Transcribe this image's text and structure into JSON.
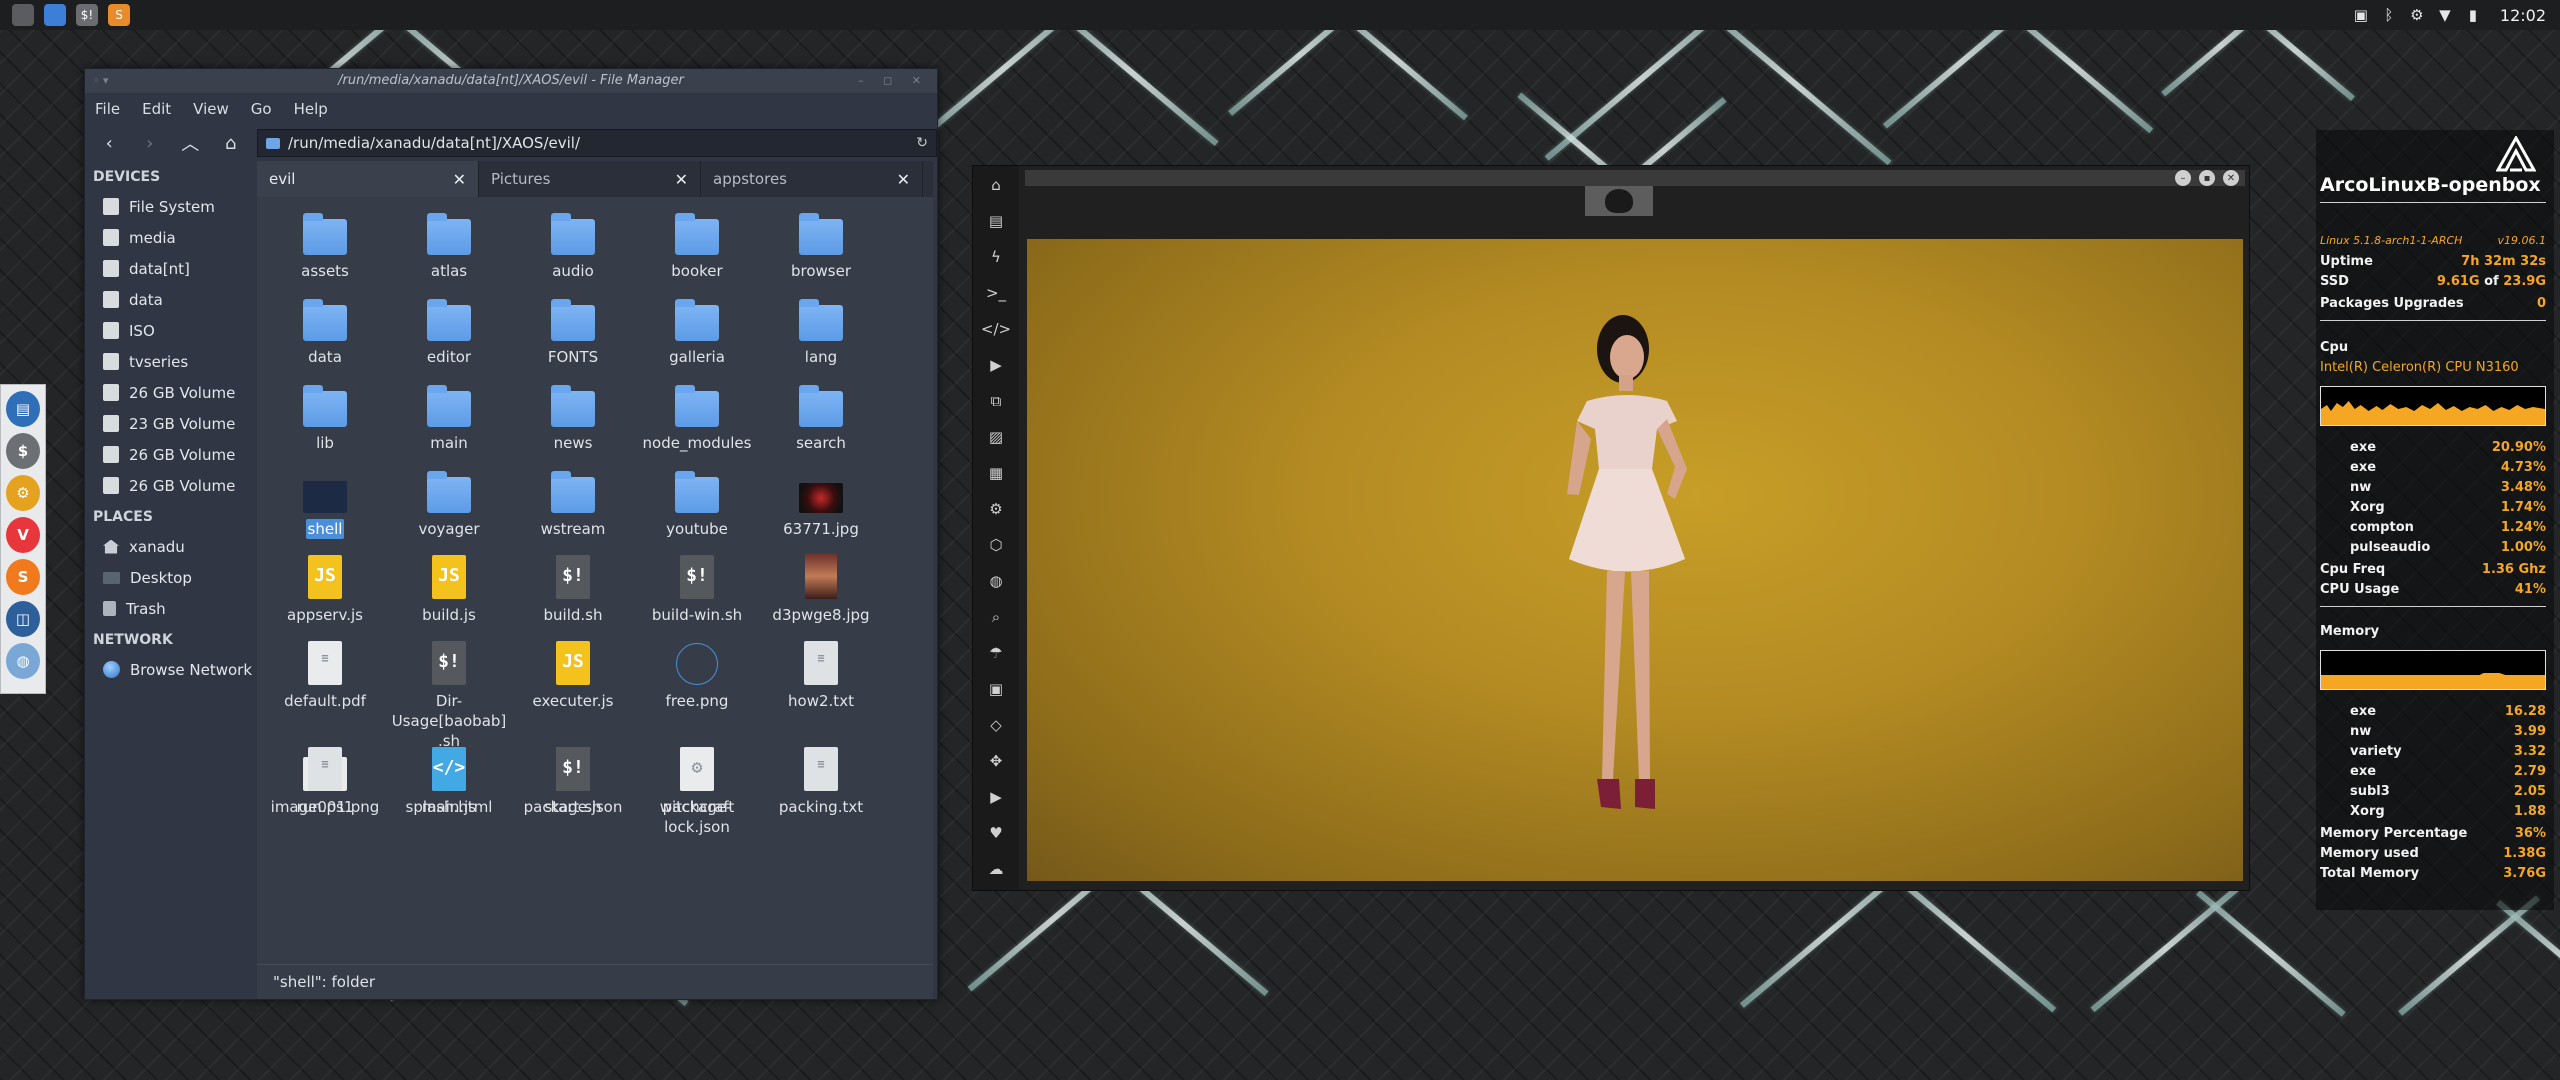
{
  "top_panel": {
    "launchers": [
      {
        "name": "app-menu-icon",
        "color": "#5a5c60"
      },
      {
        "name": "files-icon",
        "color": "#3d7fd6"
      },
      {
        "name": "terminal-icon",
        "color": "#6a6c70",
        "glyph": "$!"
      },
      {
        "name": "sublime-icon",
        "color": "#e88b2a",
        "glyph": "S"
      }
    ],
    "clock": "12:02"
  },
  "dock": {
    "items": [
      {
        "name": "dock-files-icon",
        "color": "#2f6fb8",
        "glyph": "▤"
      },
      {
        "name": "dock-terminal-icon",
        "color": "#6c6f73",
        "glyph": "$"
      },
      {
        "name": "dock-settings-icon",
        "color": "#e5a21f",
        "glyph": "⚙"
      },
      {
        "name": "dock-vivaldi-icon",
        "color": "#e8373c",
        "glyph": "V"
      },
      {
        "name": "dock-sublime-icon",
        "color": "#f07a1d",
        "glyph": "S"
      },
      {
        "name": "dock-screenshot-icon",
        "color": "#2d5f9a",
        "glyph": "◫"
      },
      {
        "name": "dock-network-icon",
        "color": "#7aa8d6",
        "glyph": "◍"
      }
    ]
  },
  "file_manager": {
    "title": "/run/media/xanadu/data[nt]/XAOS/evil - File Manager",
    "menu": [
      "File",
      "Edit",
      "View",
      "Go",
      "Help"
    ],
    "path": "/run/media/xanadu/data[nt]/XAOS/evil/",
    "sidebar": {
      "devices_header": "DEVICES",
      "devices": [
        "File System",
        "media",
        "data[nt]",
        "data",
        "ISO",
        "tvseries",
        "26 GB Volume",
        "23 GB Volume",
        "26 GB Volume",
        "26 GB Volume"
      ],
      "places_header": "PLACES",
      "places": [
        "xanadu",
        "Desktop",
        "Trash"
      ],
      "network_header": "NETWORK",
      "network": [
        "Browse Network"
      ]
    },
    "tabs": [
      {
        "label": "evil",
        "active": true
      },
      {
        "label": "Pictures",
        "active": false
      },
      {
        "label": "appstores",
        "active": false
      }
    ],
    "files": [
      {
        "name": "assets",
        "type": "folder"
      },
      {
        "name": "atlas",
        "type": "folder"
      },
      {
        "name": "audio",
        "type": "folder"
      },
      {
        "name": "booker",
        "type": "folder"
      },
      {
        "name": "browser",
        "type": "folder"
      },
      {
        "name": "data",
        "type": "folder"
      },
      {
        "name": "editor",
        "type": "folder"
      },
      {
        "name": "FONTS",
        "type": "folder"
      },
      {
        "name": "galleria",
        "type": "folder"
      },
      {
        "name": "lang",
        "type": "folder"
      },
      {
        "name": "lib",
        "type": "folder"
      },
      {
        "name": "main",
        "type": "folder"
      },
      {
        "name": "news",
        "type": "folder"
      },
      {
        "name": "node_modules",
        "type": "folder"
      },
      {
        "name": "search",
        "type": "folder"
      },
      {
        "name": "shell",
        "type": "folder-dark",
        "selected": true
      },
      {
        "name": "voyager",
        "type": "folder"
      },
      {
        "name": "wstream",
        "type": "folder"
      },
      {
        "name": "youtube",
        "type": "folder"
      },
      {
        "name": "63771.jpg",
        "type": "image-red"
      },
      {
        "name": "appserv.js",
        "type": "js"
      },
      {
        "name": "build.js",
        "type": "js"
      },
      {
        "name": "build.sh",
        "type": "sh"
      },
      {
        "name": "build-win.sh",
        "type": "sh"
      },
      {
        "name": "d3pwge8.jpg",
        "type": "image-portrait"
      },
      {
        "name": "default.pdf",
        "type": "pdf"
      },
      {
        "name": "Dir-Usage[baobab].sh",
        "type": "sh"
      },
      {
        "name": "executer.js",
        "type": "js"
      },
      {
        "name": "free.png",
        "type": "png-empty"
      },
      {
        "name": "how2.txt",
        "type": "txt"
      },
      {
        "name": "image001.png",
        "type": "image-chrome"
      },
      {
        "name": "main.js",
        "type": "js"
      },
      {
        "name": "package.json",
        "type": "json"
      },
      {
        "name": "package-lock.json",
        "type": "json"
      },
      {
        "name": "packing.txt",
        "type": "txt"
      },
      {
        "name": "run.ps1",
        "type": "txt"
      },
      {
        "name": "splash.html",
        "type": "html"
      },
      {
        "name": "start.sh",
        "type": "sh"
      },
      {
        "name": "witchcraft",
        "type": "gear"
      }
    ],
    "status": "\"shell\": folder"
  },
  "image_viewer": {
    "sidebar_icons": [
      "home-icon",
      "document-icon",
      "flash-icon",
      "terminal-icon",
      "code-icon",
      "play-icon",
      "copy-icon",
      "image-icon",
      "news-icon",
      "settings-icon",
      "hexagon-icon",
      "globe-icon",
      "search-icon",
      "umbrella-icon",
      "contact-icon",
      "embed-icon",
      "expand-icon",
      "youtube-icon",
      "heart-icon",
      "cloud-icon"
    ]
  },
  "conky": {
    "hostname": "ArcoLinuxB-openbox",
    "kernel": "Linux 5.1.8-arch1-1-ARCH",
    "version": "v19.06.1",
    "uptime_label": "Uptime",
    "uptime": "7h 32m 32s",
    "ssd_label": "SSD",
    "ssd_used": "9.61G",
    "ssd_of": "of",
    "ssd_total": "23.9G",
    "pkg_label": "Packages Upgrades",
    "pkg_value": "0",
    "cpu_header": "Cpu",
    "cpu_model": "Intel(R) Celeron(R) CPU  N3160",
    "cpu_procs": [
      {
        "name": "exe",
        "value": "20.90%"
      },
      {
        "name": "exe",
        "value": "4.73%"
      },
      {
        "name": "nw",
        "value": "3.48%"
      },
      {
        "name": "Xorg",
        "value": "1.74%"
      },
      {
        "name": "compton",
        "value": "1.24%"
      },
      {
        "name": "pulseaudio",
        "value": "1.00%"
      }
    ],
    "cpu_freq_label": "Cpu Freq",
    "cpu_freq": "1.36 Ghz",
    "cpu_usage_label": "CPU Usage",
    "cpu_usage": "41%",
    "mem_header": "Memory",
    "mem_procs": [
      {
        "name": "exe",
        "value": "16.28"
      },
      {
        "name": "nw",
        "value": "3.99"
      },
      {
        "name": "variety",
        "value": "3.32"
      },
      {
        "name": "exe",
        "value": "2.79"
      },
      {
        "name": "subl3",
        "value": "2.05"
      },
      {
        "name": "Xorg",
        "value": "1.88"
      }
    ],
    "mem_pct_label": "Memory Percentage",
    "mem_pct": "36%",
    "mem_used_label": "Memory used",
    "mem_used": "1.38G",
    "mem_total_label": "Total Memory",
    "mem_total": "3.76G"
  }
}
